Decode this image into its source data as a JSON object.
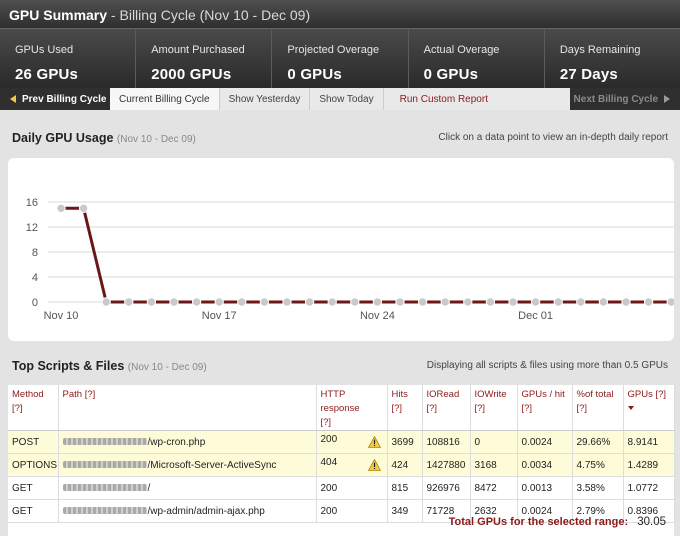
{
  "header": {
    "title": "GPU Summary",
    "subtitle": "Billing Cycle (Nov 10 - Dec 09)",
    "title_sep": " - "
  },
  "stats": [
    {
      "label": "GPUs Used",
      "value": "26 GPUs"
    },
    {
      "label": "Amount Purchased",
      "value": "2000 GPUs"
    },
    {
      "label": "Projected Overage",
      "value": "0 GPUs"
    },
    {
      "label": "Actual Overage",
      "value": "0 GPUs"
    },
    {
      "label": "Days Remaining",
      "value": "27 Days"
    }
  ],
  "nav": {
    "prev": "Prev Billing Cycle",
    "tabs": [
      "Current Billing Cycle",
      "Show Yesterday",
      "Show Today"
    ],
    "custom": "Run Custom Report",
    "next": "Next Billing Cycle"
  },
  "usage": {
    "title": "Daily GPU Usage",
    "range": "(Nov 10 - Dec 09)",
    "note": "Click on a data point to view an in-depth daily report"
  },
  "chart_data": {
    "type": "line",
    "title": "Daily GPU Usage",
    "subtitle": "(Nov 10 - Dec 09)",
    "ylim": [
      0,
      17
    ],
    "yticks": [
      "0",
      "4",
      "8",
      "12",
      "16"
    ],
    "ytick_values": [
      0,
      4,
      8,
      12,
      16
    ],
    "xtick_labels": [
      "Nov 10",
      "Nov 17",
      "Nov 24",
      "Dec 01"
    ],
    "xtick_index": [
      0,
      7,
      14,
      21
    ],
    "grid": true,
    "series": [
      {
        "color": "#6b1717",
        "values": [
          15,
          15,
          0,
          0,
          0,
          0,
          0,
          0,
          0,
          0,
          0,
          0,
          0,
          0,
          0,
          0,
          0,
          0,
          0,
          0,
          0,
          0,
          0,
          0,
          0,
          0,
          0,
          0,
          0,
          0
        ]
      }
    ]
  },
  "scripts": {
    "title": "Top Scripts & Files",
    "range": "(Nov 10 - Dec 09)",
    "note": "Displaying all scripts & files using more than 0.5 GPUs",
    "columns": [
      "Method",
      "Path",
      "HTTP response",
      "Hits",
      "IORead",
      "IOWrite",
      "GPUs / hit",
      "%of total",
      "GPUs"
    ],
    "help": "[?]",
    "rows": [
      {
        "method": "POST",
        "path": "/wp-cron.php",
        "http": "200",
        "warn": true,
        "hits": "3699",
        "ioread": "108816",
        "iowrite": "0",
        "per_hit": "0.0024",
        "pct": "29.66%",
        "gpus": "8.9141"
      },
      {
        "method": "OPTIONS",
        "path": "/Microsoft-Server-ActiveSync",
        "http": "404",
        "warn": true,
        "hits": "424",
        "ioread": "1427880",
        "iowrite": "3168",
        "per_hit": "0.0034",
        "pct": "4.75%",
        "gpus": "1.4289"
      },
      {
        "method": "GET",
        "path": "/",
        "http": "200",
        "warn": false,
        "hits": "815",
        "ioread": "926976",
        "iowrite": "8472",
        "per_hit": "0.0013",
        "pct": "3.58%",
        "gpus": "1.0772"
      },
      {
        "method": "GET",
        "path": "/wp-admin/admin-ajax.php",
        "http": "200",
        "warn": false,
        "hits": "349",
        "ioread": "71728",
        "iowrite": "2632",
        "per_hit": "0.0024",
        "pct": "2.79%",
        "gpus": "0.8396"
      }
    ],
    "total_label": "Total GPUs for the selected range:",
    "total_value": "30.05"
  },
  "colors": {
    "accent": "#8b1a1a",
    "line": "#6b1717",
    "highlight_row": "#fdfbd8",
    "warn": "#f2c94c"
  },
  "icons": {
    "warning": "warning-icon",
    "prev": "arrow-left-icon",
    "next": "arrow-right-icon",
    "sort": "sort-desc-icon"
  }
}
